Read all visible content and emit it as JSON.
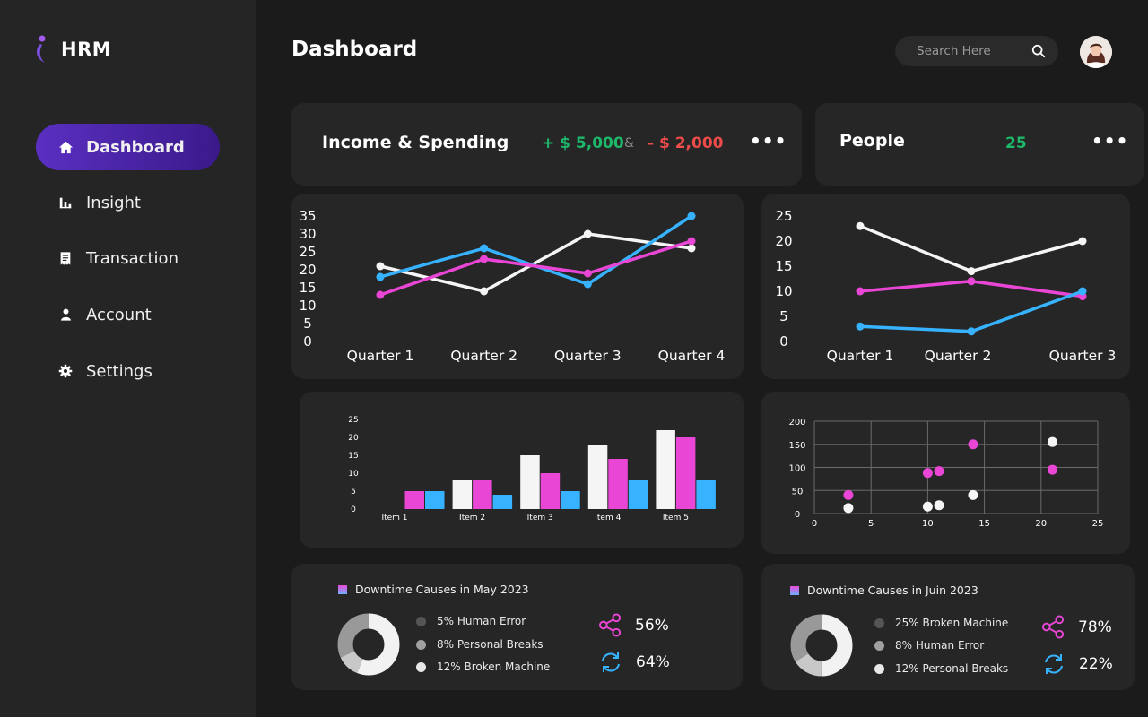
{
  "app": {
    "name": "HRM"
  },
  "sidebar": {
    "items": [
      {
        "label": "Dashboard",
        "icon": "home-icon",
        "active": true
      },
      {
        "label": "Insight",
        "icon": "bar-chart-icon"
      },
      {
        "label": "Transaction",
        "icon": "receipt-icon"
      },
      {
        "label": "Account",
        "icon": "user-icon"
      },
      {
        "label": "Settings",
        "icon": "gear-icon"
      }
    ]
  },
  "header": {
    "title": "Dashboard",
    "search_placeholder": "Search Here"
  },
  "income": {
    "title": "Income & Spending",
    "income": "+ $ 5,000",
    "separator": "&",
    "spending": "- $ 2,000"
  },
  "people": {
    "title": "People",
    "count": "25"
  },
  "colors": {
    "pink": "#e946d5",
    "blue": "#36b2ff",
    "white": "#f5f5f5",
    "green": "#1db86a",
    "red": "#ef4b4b",
    "accent": "#5a2fc2"
  },
  "chart_data": [
    {
      "type": "line",
      "categories": [
        "Quarter 1",
        "Quarter 2",
        "Quarter 3",
        "Quarter 4"
      ],
      "yticks": [
        0,
        5,
        10,
        15,
        20,
        25,
        30,
        35
      ],
      "ylim": [
        0,
        35
      ],
      "series": [
        {
          "color": "#f5f5f5",
          "values": [
            21,
            14,
            30,
            26
          ]
        },
        {
          "color": "#36b2ff",
          "values": [
            18,
            26,
            16,
            35
          ]
        },
        {
          "color": "#e946d5",
          "values": [
            13,
            23,
            19,
            28
          ]
        }
      ]
    },
    {
      "type": "line",
      "categories": [
        "Quarter 1",
        "Quarter 2",
        "Quarter 3"
      ],
      "yticks": [
        0,
        5,
        10,
        15,
        20,
        25
      ],
      "ylim": [
        0,
        25
      ],
      "series": [
        {
          "color": "#f5f5f5",
          "values": [
            23,
            14,
            20
          ]
        },
        {
          "color": "#e946d5",
          "values": [
            10,
            12,
            9
          ]
        },
        {
          "color": "#36b2ff",
          "values": [
            3,
            2,
            10
          ]
        }
      ]
    },
    {
      "type": "bar",
      "categories": [
        "Item 1",
        "Item 2",
        "Item 3",
        "Item 4",
        "Item 5"
      ],
      "yticks": [
        0,
        5,
        10,
        15,
        20,
        25
      ],
      "ylim": [
        0,
        25
      ],
      "series": [
        {
          "color": "#f5f5f5",
          "values": [
            0,
            8,
            15,
            18,
            22
          ]
        },
        {
          "color": "#e946d5",
          "values": [
            5,
            8,
            10,
            14,
            20
          ]
        },
        {
          "color": "#36b2ff",
          "values": [
            5,
            4,
            5,
            8,
            8
          ]
        }
      ]
    },
    {
      "type": "scatter",
      "xticks": [
        0,
        5,
        10,
        15,
        20,
        25
      ],
      "yticks": [
        0,
        50,
        100,
        150,
        200
      ],
      "xlim": [
        0,
        25
      ],
      "ylim": [
        0,
        200
      ],
      "grid": true,
      "series": [
        {
          "color": "#e946d5",
          "points": [
            [
              3,
              40
            ],
            [
              10,
              88
            ],
            [
              11,
              92
            ],
            [
              14,
              150
            ],
            [
              21,
              95
            ]
          ]
        },
        {
          "color": "#f5f5f5",
          "points": [
            [
              3,
              12
            ],
            [
              10,
              15
            ],
            [
              11,
              18
            ],
            [
              14,
              40
            ],
            [
              21,
              155
            ]
          ]
        }
      ]
    }
  ],
  "downtime_may": {
    "title": "Downtime Causes in May 2023",
    "donut": [
      56,
      12,
      32
    ],
    "items": [
      {
        "label": "5%  Human Error",
        "color": "#555555"
      },
      {
        "label": "8% Personal Breaks",
        "color": "#a0a0a0"
      },
      {
        "label": "12% Broken Machine",
        "color": "#e8e8e8"
      }
    ],
    "share_value": "56%",
    "sync_value": "64%"
  },
  "downtime_june": {
    "title": "Downtime Causes in Juin 2023",
    "donut": [
      50,
      16,
      34
    ],
    "items": [
      {
        "label": "25% Broken Machine",
        "color": "#555555"
      },
      {
        "label": "8% Human Error",
        "color": "#a0a0a0"
      },
      {
        "label": "12% Personal Breaks",
        "color": "#e8e8e8"
      }
    ],
    "share_value": "78%",
    "sync_value": "22%"
  }
}
